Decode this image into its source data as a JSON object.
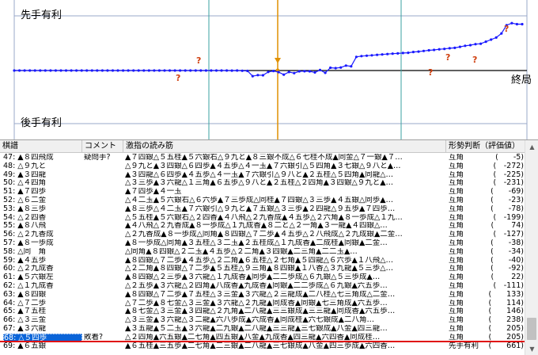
{
  "graph": {
    "label_sente": "先手有利",
    "label_gote": "後手有利",
    "label_end": "終局",
    "question_mark": "?",
    "series_color": "#1a1aff",
    "cursor_color": "#e09000"
  },
  "chart_data": {
    "type": "line",
    "series": [
      {
        "values": [
          0,
          0,
          0,
          0,
          0,
          0,
          0,
          0,
          0,
          0,
          0,
          0,
          0,
          0,
          0,
          0,
          0,
          0,
          0,
          0,
          0,
          0,
          0,
          0,
          0,
          0,
          0,
          0,
          0,
          0,
          0,
          0,
          0,
          0,
          0,
          0,
          0,
          0,
          0,
          0,
          0,
          0,
          -3,
          0,
          -10,
          -20,
          -272,
          -225,
          -231,
          -69,
          -23,
          -78,
          -199,
          -74,
          -127,
          -38,
          -34,
          -40,
          -92,
          22,
          -111,
          133,
          114,
          146,
          238,
          205,
          661,
          700,
          720,
          740,
          760,
          780,
          800,
          820,
          830,
          850,
          860,
          900,
          920,
          950,
          980,
          1000,
          1030,
          1050,
          1080,
          1100,
          1150,
          1200,
          1230,
          1280,
          1300,
          1400,
          1500,
          1600,
          1800,
          2200,
          2300,
          2250,
          2250
        ]
      }
    ],
    "annotations": [
      "?",
      "?",
      "?",
      "?",
      "?",
      "?"
    ]
  },
  "list": {
    "headers": {
      "move": "棋譜",
      "comment": "コメント",
      "pv": "激指の読み筋",
      "judge": "形勢判断（評価値）"
    },
    "rows": [
      {
        "move": "47: ▲８四飛成",
        "comment": "疑問手?",
        "pv": "▲７四銀△５五桂▲５六銀右△９九と▲８三銀不成△６七桂不成▲同金△７一銀▲７…",
        "judge": "互角",
        "eval": "(　　-5)"
      },
      {
        "move": "48: △９九と",
        "comment": "",
        "pv": "△９九と▲３四銀△６四歩▲４五歩△４一玉▲７六銀引△５四角▲３七銀△９八と▲…",
        "judge": "互角",
        "eval": "(　-272)"
      },
      {
        "move": "49: ▲３四龍",
        "comment": "",
        "pv": "▲３四龍△６四歩▲４五歩△４一玉▲７六銀引△９八と▲２五桂△５四角▲同龍△…",
        "judge": "互角",
        "eval": "(　-225)"
      },
      {
        "move": "50: △４四角",
        "comment": "",
        "pv": "△３三歩▲３六龍△１三角▲６五歩△９八と▲２五桂△２四角▲３四銀△９九と▲…",
        "judge": "互角",
        "eval": "(　-231)"
      },
      {
        "move": "51: ▲７四歩",
        "comment": "",
        "pv": "▲７四歩▲４一玉",
        "judge": "互角",
        "eval": "(　　-69)"
      },
      {
        "move": "52: △６二金",
        "comment": "",
        "pv": "△４二玉▲５六銀右△６六歩▲７三歩成△同桂▲７四銀△３三歩▲４五銀△同歩▲…",
        "judge": "互角",
        "eval": "(　　-23)"
      },
      {
        "move": "53: ▲８三歩",
        "comment": "",
        "pv": "▲８三歩△４二玉▲７六銀引△９九と▲７五銀△３三歩▲２四龍△９五歩▲７四歩…",
        "judge": "互角",
        "eval": "(　　-78)"
      },
      {
        "move": "54: △２四香",
        "comment": "",
        "pv": "△５五桂▲５六銀右△２四香▲４八飛△２九香成▲４五歩△２六角▲８一歩成△１九…",
        "judge": "互角",
        "eval": "(　-199)"
      },
      {
        "move": "55: ▲８八飛",
        "comment": "",
        "pv": "▲４八飛△２九香成▲８一歩成△１九成香▲８二と△２一角▲３一龍▲４四銀△…",
        "judge": "互角",
        "eval": "(　　 74)"
      },
      {
        "move": "56: △２九香成",
        "comment": "",
        "pv": "△２九香成▲８一歩成△同角▲８四銀△７二歩▲４五歩△２八飛成△２九成銀▲二金…",
        "judge": "互角",
        "eval": "(　-127)"
      },
      {
        "move": "57: ▲８一歩成",
        "comment": "",
        "pv": "▲８一歩成△同角▲３五桂△３二玉▲２五桂成△１九成香▲二成桂▲同銀▲二金…",
        "judge": "互角",
        "eval": "(　　-38)"
      },
      {
        "move": "58: △同　角",
        "comment": "",
        "pv": "△同角▲８四銀△２二玉▲４五歩△２二角▲３四銀▲二三角▲二二玉▲…",
        "judge": "互角",
        "eval": "(　　-34)"
      },
      {
        "move": "59: ▲４五歩",
        "comment": "",
        "pv": "▲８四銀△７二歩▲４五歩△２二角▲６五桂△２七角▲５四龍△６六歩▲１八飛△…",
        "judge": "互角",
        "eval": "(　　-40)"
      },
      {
        "move": "60: △２九成香",
        "comment": "",
        "pv": "△２二角▲８四銀△７二歩▲５五桂△９三角▲８四銀▲１八香△３九龍▲５三歩△…",
        "judge": "互角",
        "eval": "(　　-92)"
      },
      {
        "move": "61: ▲５六銀左",
        "comment": "",
        "pv": "▲８四銀△２三歩▲３六龍△１九成香▲同歩▲二二歩成△６九銀△５三歩成▲…",
        "judge": "互角",
        "eval": "(　　 22)"
      },
      {
        "move": "62: △１九成香",
        "comment": "",
        "pv": "△２五歩▲３六龍△２四角▲八成香▲九成香▲同銀▲二二歩成△６九銀▲六五歩…",
        "judge": "互角",
        "eval": "(　-111)"
      },
      {
        "move": "63: ▲８四銀",
        "comment": "",
        "pv": "▲８四銀△７二歩▲７五桂△３三金▲３六龍△２三龍成▲二八桂△七三角成△二金…",
        "judge": "互角",
        "eval": "(　　133)"
      },
      {
        "move": "64: △７二歩",
        "comment": "",
        "pv": "△７二歩▲８七金△３三金▲３六龍△２九龍▲同成香▲同銀▲七三角成▲六五歩…",
        "judge": "互角",
        "eval": "(　　114)"
      },
      {
        "move": "65: ▲７五桂",
        "comment": "",
        "pv": "▲８七金△３三金▲３四龍△２九角▲二八龍▲三三銀成▲三三龍▲同成香▲六五歩…",
        "judge": "互角",
        "eval": "(　　146)"
      },
      {
        "move": "66: △３三金",
        "comment": "",
        "pv": "△３三金▲３六龍△３二龍▲六八歩成▲六成香▲同成桂▲六七銀成▲二八角…",
        "judge": "互角",
        "eval": "(　　238)"
      },
      {
        "move": "67: ▲３六龍",
        "comment": "",
        "pv": "▲３五龍▲５二玉▲３六龍▲二九銀▲二八龍▲三三龍▲三七銀成▲八金▲四三龍…",
        "judge": "互角",
        "eval": "(　　205)"
      },
      {
        "move": "68: △５四歩",
        "comment": "敗着?",
        "pv": "△２四角▲六五銀▲二七角▲四五銀▲八金▲九成香▲四三龍▲六四香▲同成桂…",
        "judge": "互角",
        "eval": "(　　205)"
      },
      {
        "move": "69: ▲６五銀",
        "comment": "",
        "pv": "▲６五桂▲三五歩▲二七角▲二三銀▲二八龍▲三七銀成▲八金▲四三歩成▲六四香…",
        "judge": "先手有利",
        "eval": "(　　661)"
      }
    ]
  }
}
